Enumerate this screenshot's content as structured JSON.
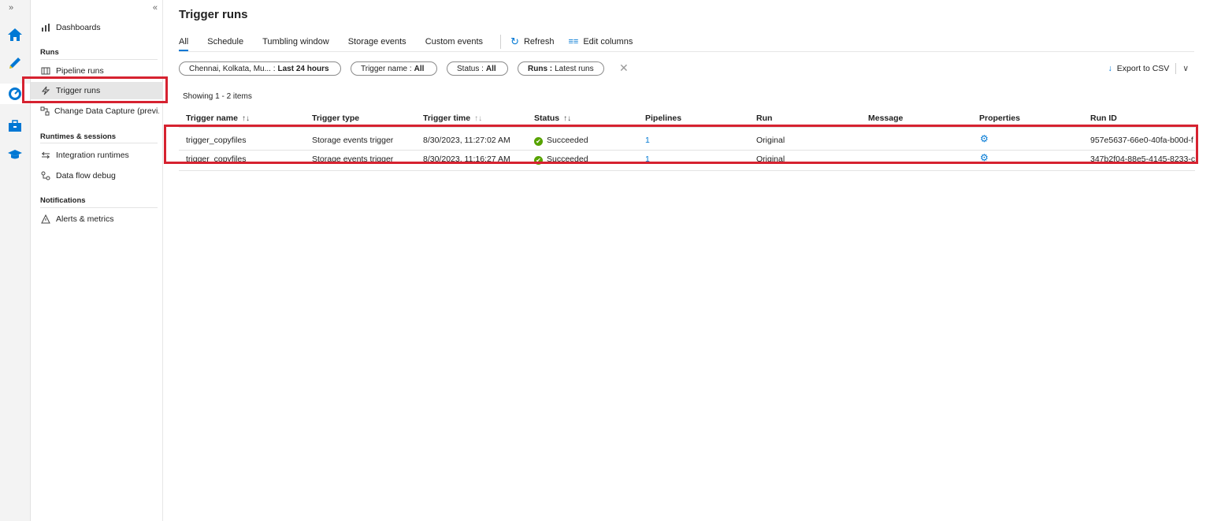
{
  "rail": {
    "expand": "»"
  },
  "sidenav": {
    "collapse": "«",
    "dashboards": "Dashboards",
    "runs_header": "Runs",
    "pipeline_runs": "Pipeline runs",
    "trigger_runs": "Trigger runs",
    "change_data_capture": "Change Data Capture (previ...",
    "runtimes_header": "Runtimes & sessions",
    "integration_runtimes": "Integration runtimes",
    "data_flow_debug": "Data flow debug",
    "notifications_header": "Notifications",
    "alerts_metrics": "Alerts & metrics"
  },
  "page": {
    "title": "Trigger runs"
  },
  "tabs": [
    {
      "label": "All"
    },
    {
      "label": "Schedule"
    },
    {
      "label": "Tumbling window"
    },
    {
      "label": "Storage events"
    },
    {
      "label": "Custom events"
    }
  ],
  "toolbar": {
    "refresh": "Refresh",
    "edit_columns": "Edit columns",
    "export": "Export to CSV"
  },
  "filters": {
    "time_label": "Chennai, Kolkata, Mu... :",
    "time_value": "Last 24 hours",
    "trigger_label": "Trigger name :",
    "trigger_value": "All",
    "status_label": "Status :",
    "status_value": "All",
    "runs_label": "Runs :",
    "runs_value": "Latest runs"
  },
  "showing": "Showing 1 - 2 items",
  "columns": {
    "trigger_name": "Trigger name",
    "trigger_type": "Trigger type",
    "trigger_time": "Trigger time",
    "status": "Status",
    "pipelines": "Pipelines",
    "run": "Run",
    "message": "Message",
    "properties": "Properties",
    "run_id": "Run ID"
  },
  "rows": [
    {
      "name": "trigger_copyfiles",
      "type": "Storage events trigger",
      "time": "8/30/2023, 11:27:02 AM",
      "status": "Succeeded",
      "pipelines": "1",
      "run": "Original",
      "message": "",
      "run_id": "957e5637-66e0-40fa-b00d-f"
    },
    {
      "name": "trigger_copyfiles",
      "type": "Storage events trigger",
      "time": "8/30/2023, 11:16:27 AM",
      "status": "Succeeded",
      "pipelines": "1",
      "run": "Original",
      "message": "",
      "run_id": "347b2f04-88e5-4145-8233-c"
    }
  ],
  "colors": {
    "accent": "#0078d4",
    "highlight": "#d62230",
    "success": "#57a300"
  }
}
